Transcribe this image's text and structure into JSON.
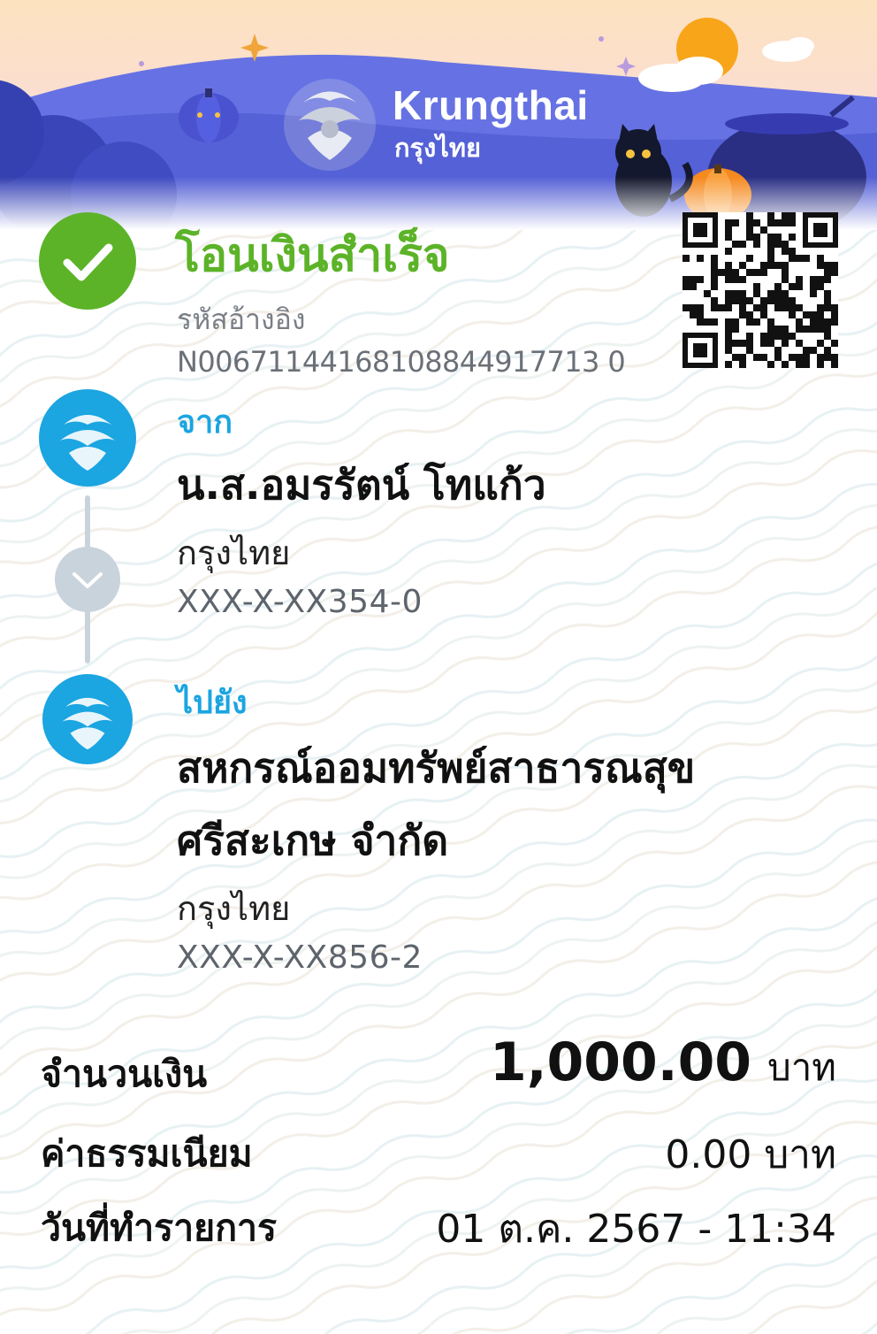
{
  "colors": {
    "success_green": "#5cb328",
    "accent_blue": "#1ba5e1",
    "header_purple": "#5663d9",
    "timeline_gray": "#c9d3dc"
  },
  "header": {
    "brand_name": "Krungthai",
    "brand_name_th": "กรุงไทย",
    "logo_icon": "krungthai-phoenix-logo",
    "decorations": [
      "pumpkin-icon",
      "black-cat-icon",
      "cauldron-icon",
      "moon-icon",
      "cloud-icon",
      "sparkle-icon"
    ]
  },
  "status": {
    "icon": "check-icon",
    "title": "โอนเงินสำเร็จ",
    "ref_label": "รหัสอ้างอิง",
    "ref_value": "N00671144168108844917713 0"
  },
  "qr": {
    "icon": "qr-code"
  },
  "from": {
    "label": "จาก",
    "name": "น.ส.อมรรัตน์ โทแก้ว",
    "bank": "กรุงไทย",
    "account": "XXX-X-XX354-0"
  },
  "to": {
    "label": "ไปยัง",
    "name_line1": "สหกรณ์ออมทรัพย์สาธารณสุข",
    "name_line2": "ศรีสะเกษ จำกัด",
    "bank": "กรุงไทย",
    "account": "XXX-X-XX856-2"
  },
  "summary": {
    "amount_label": "จำนวนเงิน",
    "amount_value": "1,000.00",
    "amount_unit": "บาท",
    "fee_label": "ค่าธรรมเนียม",
    "fee_value": "0.00 บาท",
    "date_label": "วันที่ทำรายการ",
    "date_value": "01 ต.ค. 2567 - 11:34"
  }
}
